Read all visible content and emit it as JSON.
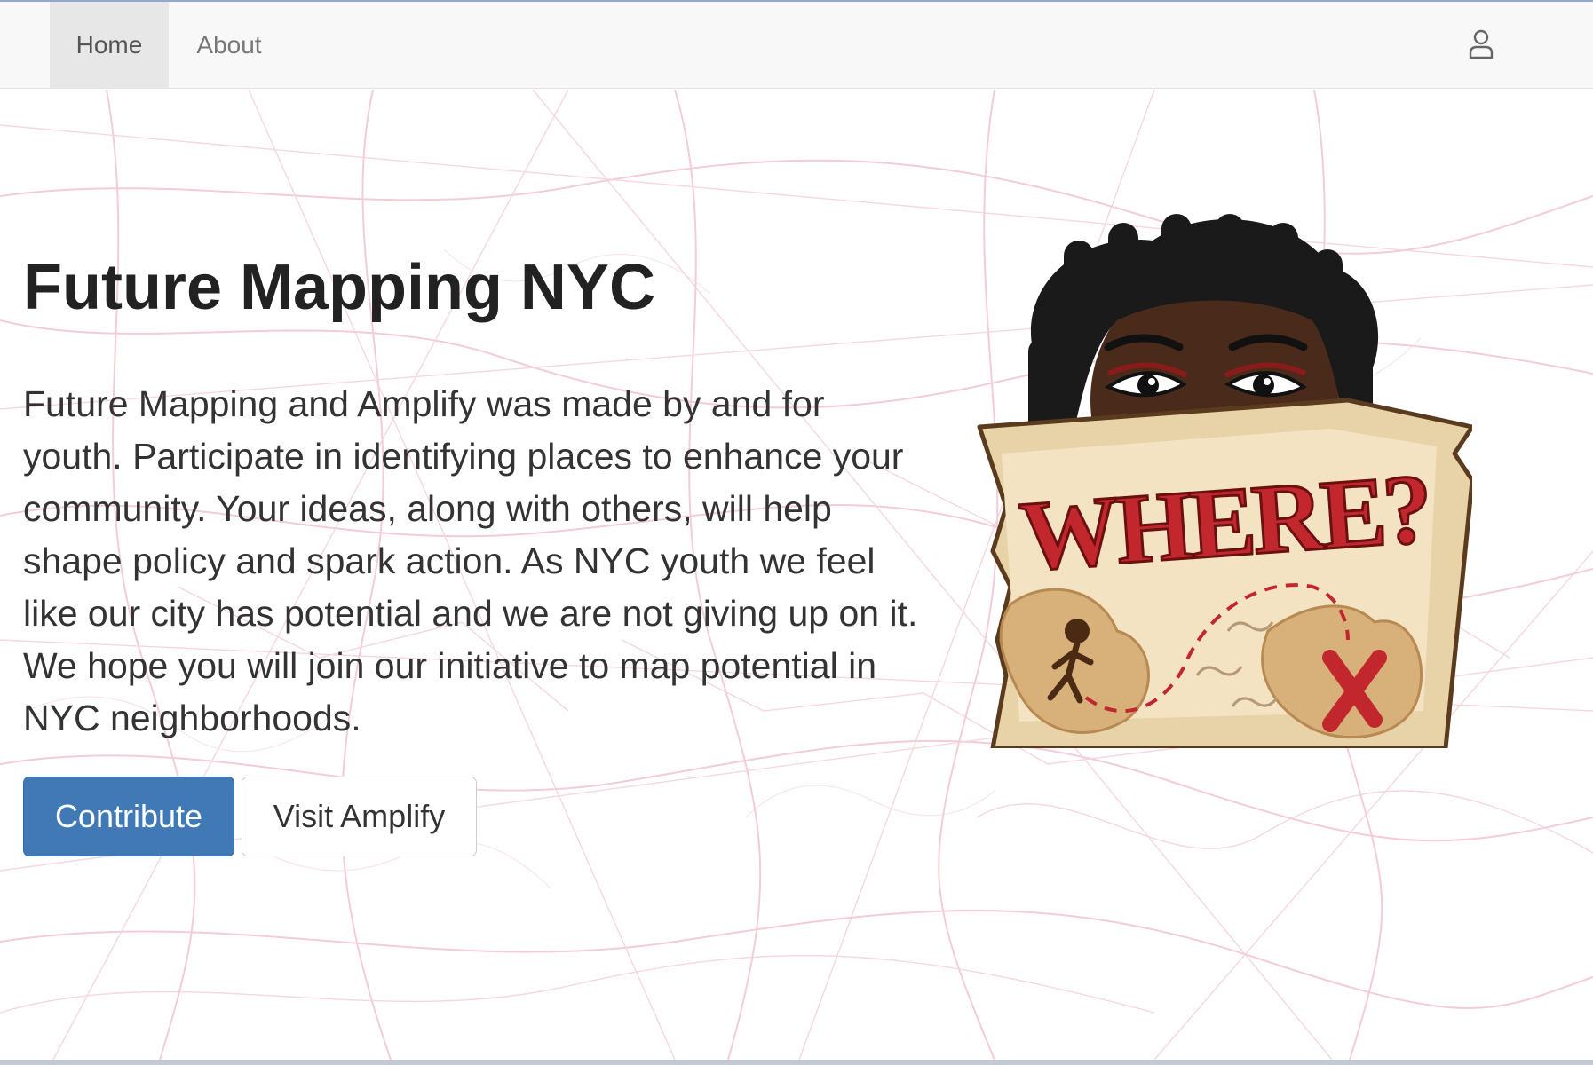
{
  "nav": {
    "items": [
      {
        "label": "Home",
        "active": true
      },
      {
        "label": "About",
        "active": false
      }
    ],
    "user_icon": "user-icon"
  },
  "hero": {
    "title": "Future Mapping NYC",
    "lead": "Future Mapping and Amplify was made by and for youth. Participate in identifying places to enhance your community. Your ideas, along with others, will help shape policy and spark action. As NYC youth we feel like our city has potential and we are not giving up on it. We hope you will join our initiative to map potential in NYC neighborhoods.",
    "primary_button": "Contribute",
    "secondary_button": "Visit Amplify"
  },
  "illustration": {
    "sign_text": "WHERE?"
  },
  "colors": {
    "primary": "#4179b6",
    "navbar_bg": "#f8f8f8",
    "active_tab_bg": "#e7e7e7",
    "map_lines": "#f2c4cf",
    "sign_red": "#c1272d"
  }
}
